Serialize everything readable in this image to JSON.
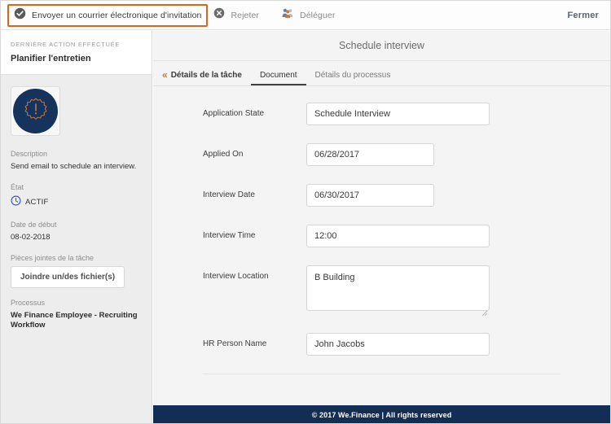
{
  "toolbar": {
    "primary_action": "Envoyer un courrier électronique d'invitation",
    "primary_icon": "check-circle-icon",
    "reject_action": "Rejeter",
    "reject_icon": "x-circle-icon",
    "delegate_action": "Déléguer",
    "delegate_icon": "people-group-icon",
    "close_label": "Fermer",
    "highlight_color": "#d2691e"
  },
  "sidebar": {
    "kicker": "DERNIÈRE ACTION EFFECTUÉE",
    "last_action": "Planifier l'entretien",
    "avatar_icon": "alert-burst-icon",
    "avatar_bg": "#15335c",
    "avatar_accent": "#c8793a",
    "description_label": "Description",
    "description_value": "Send email to schedule an interview.",
    "state_label": "État",
    "state_value": "ACTIF",
    "state_icon": "clock-circle-icon",
    "state_color": "#2d4ec8",
    "start_date_label": "Date de début",
    "start_date_value": "08-02-2018",
    "attachments_label": "Pièces jointes de la tâche",
    "attach_button": "Joindre un/des fichier(s)",
    "process_label": "Processus",
    "process_value": "We Finance Employee - Recruiting Workflow"
  },
  "main": {
    "title": "Schedule interview",
    "tabs": [
      {
        "label": "Détails de la tâche",
        "icon": "double-chevron-left-icon",
        "active": false
      },
      {
        "label": "Document",
        "active": true
      },
      {
        "label": "Détails du processus",
        "active": false
      }
    ],
    "fields": [
      {
        "label": "Application State",
        "value": "Schedule Interview",
        "type": "text"
      },
      {
        "label": "Applied On",
        "value": "06/28/2017",
        "type": "date"
      },
      {
        "label": "Interview Date",
        "value": "06/30/2017",
        "type": "date"
      },
      {
        "label": "Interview Time",
        "value": "12:00",
        "type": "time"
      },
      {
        "label": "Interview Location",
        "value": "B Building",
        "type": "textarea"
      },
      {
        "label": "HR Person Name",
        "value": "John Jacobs",
        "type": "text"
      }
    ]
  },
  "footer": {
    "text": "© 2017 We.Finance | All rights reserved",
    "background": "#132e54"
  }
}
